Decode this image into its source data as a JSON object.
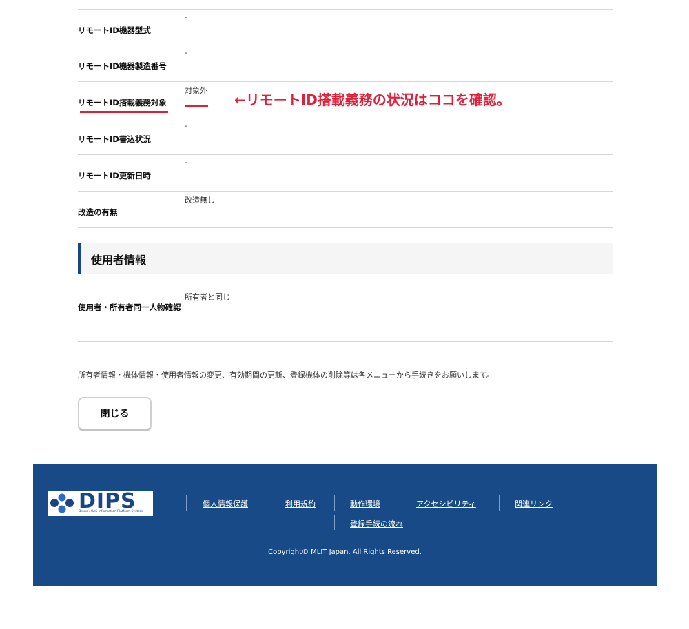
{
  "device_rows": [
    {
      "label": "リモートID機器型式",
      "value": "-"
    },
    {
      "label": "リモートID機器製造番号",
      "value": "-"
    },
    {
      "label": "リモートID搭載義務対象",
      "value": "対象外"
    },
    {
      "label": "リモートID書込状況",
      "value": "-"
    },
    {
      "label": "リモートID更新日時",
      "value": "-"
    },
    {
      "label": "改造の有無",
      "value": "改造無し"
    }
  ],
  "annotation": "←リモートID搭載義務の状況はココを確認。",
  "colors": {
    "annotation_red": "#e0203a",
    "footer_blue": "#174a86",
    "accent_blue": "#1a4585"
  },
  "user_section": {
    "title": "使用者情報",
    "row": {
      "label": "使用者・所有者同一人物確認",
      "value": "所有者と同じ"
    }
  },
  "note": "所有者情報・機体情報・使用者情報の変更、有効期間の更新、登録機体の削除等は各メニューから手続きをお願いします。",
  "close_label": "閉じる",
  "footer": {
    "logo_text": "DIPS",
    "logo_sub": "Drone / UAS Information Platform System",
    "links": [
      "個人情報保護",
      "利用規約",
      "動作環境",
      "アクセシビリティ",
      "関連リンク",
      "登録手続の流れ"
    ],
    "copyright": "Copyright© MLIT Japan. All Rights Reserved."
  }
}
